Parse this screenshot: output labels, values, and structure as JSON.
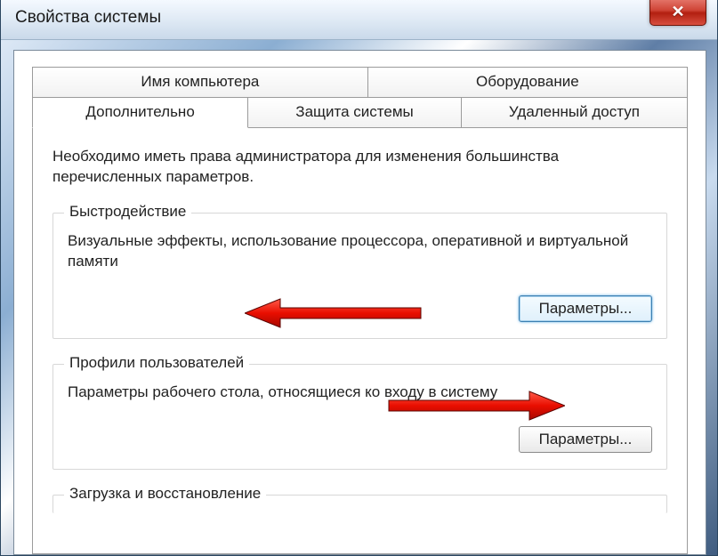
{
  "window": {
    "title": "Свойства системы"
  },
  "tabs": {
    "row1": [
      {
        "label": "Имя компьютера"
      },
      {
        "label": "Оборудование"
      }
    ],
    "row2": [
      {
        "label": "Дополнительно"
      },
      {
        "label": "Защита системы"
      },
      {
        "label": "Удаленный доступ"
      }
    ]
  },
  "panel": {
    "intro": "Необходимо иметь права администратора для изменения большинства перечисленных параметров.",
    "group_performance": {
      "legend": "Быстродействие",
      "desc": "Визуальные эффекты, использование процессора, оперативной и виртуальной памяти",
      "button": "Параметры..."
    },
    "group_profiles": {
      "legend": "Профили пользователей",
      "desc": "Параметры рабочего стола, относящиеся ко входу в систему",
      "button": "Параметры..."
    },
    "group_startup": {
      "legend": "Загрузка и восстановление"
    }
  }
}
